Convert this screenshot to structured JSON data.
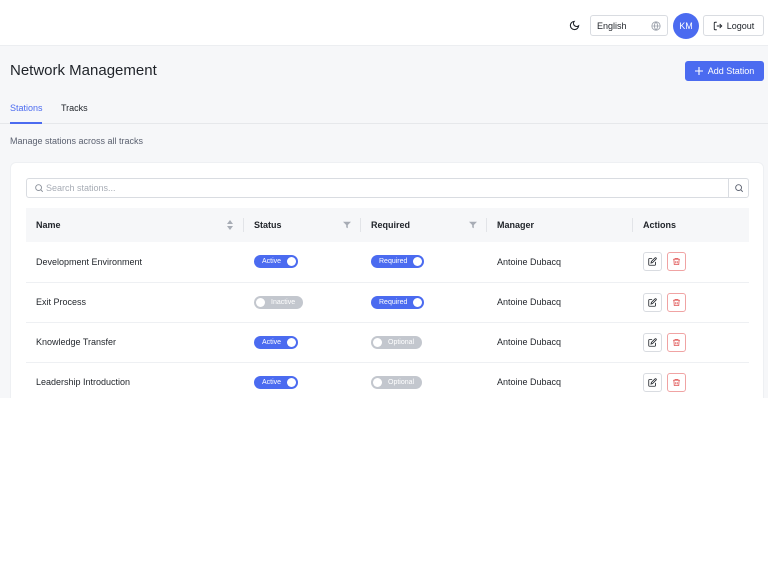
{
  "header": {
    "theme_icon": "moon-icon",
    "language": "English",
    "language_icon": "globe-icon",
    "avatar_initials": "KM",
    "logout_label": "Logout",
    "logout_icon": "logout-icon"
  },
  "page": {
    "title": "Network Management",
    "add_button": "Add Station",
    "subtitle": "Manage stations across all tracks"
  },
  "tabs": [
    {
      "label": "Stations",
      "active": true
    },
    {
      "label": "Tracks",
      "active": false
    }
  ],
  "search": {
    "placeholder": "Search stations..."
  },
  "table": {
    "columns": [
      "Name",
      "Status",
      "Required",
      "Manager",
      "Actions"
    ],
    "rows": [
      {
        "name": "Development Environment",
        "status": "Active",
        "status_on": true,
        "required": "Required",
        "required_on": true,
        "manager": "Antoine Dubacq"
      },
      {
        "name": "Exit Process",
        "status": "Inactive",
        "status_on": false,
        "required": "Required",
        "required_on": true,
        "manager": "Antoine Dubacq"
      },
      {
        "name": "Knowledge Transfer",
        "status": "Active",
        "status_on": true,
        "required": "Optional",
        "required_on": false,
        "manager": "Antoine Dubacq"
      },
      {
        "name": "Leadership Introduction",
        "status": "Active",
        "status_on": true,
        "required": "Optional",
        "required_on": false,
        "manager": "Antoine Dubacq"
      }
    ]
  },
  "colors": {
    "accent": "#4b6bf0",
    "danger": "#e05656",
    "toggle_off": "#c3c7ce"
  }
}
